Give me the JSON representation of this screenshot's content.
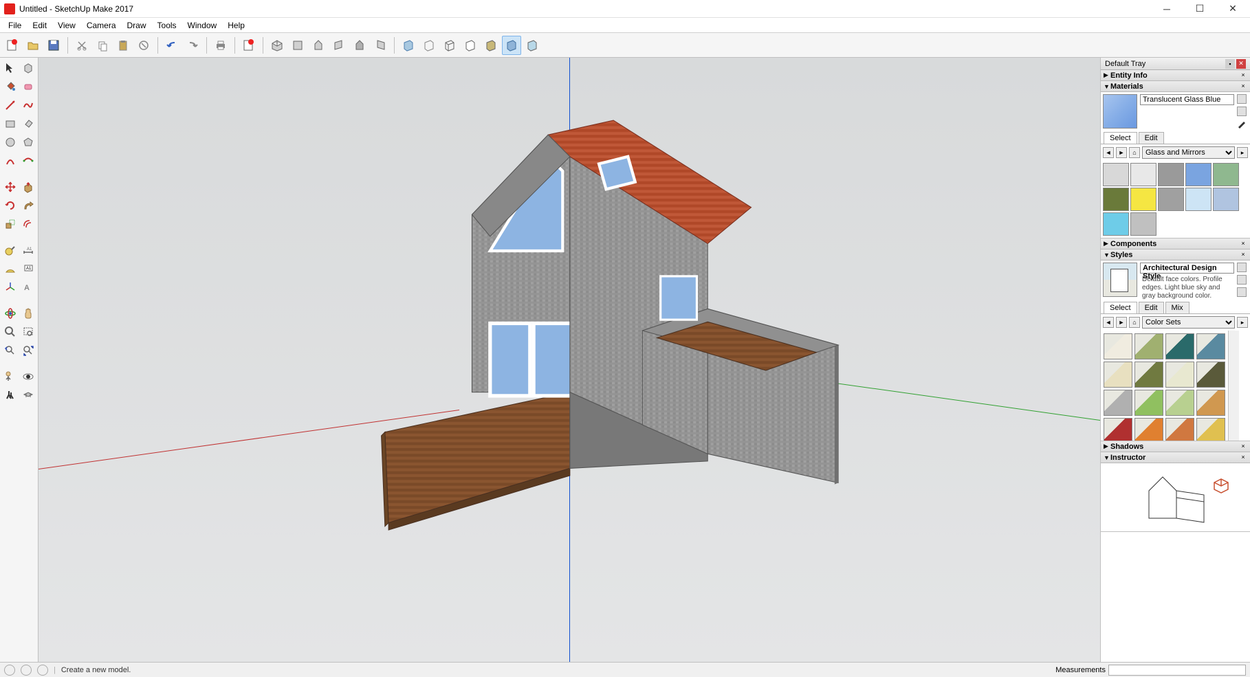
{
  "title": "Untitled - SketchUp Make 2017",
  "menu": [
    "File",
    "Edit",
    "View",
    "Camera",
    "Draw",
    "Tools",
    "Window",
    "Help"
  ],
  "tray": {
    "title": "Default Tray",
    "panels": {
      "entity_info": "Entity Info",
      "materials": {
        "title": "Materials",
        "name": "Translucent Glass Blue",
        "tabs": [
          "Select",
          "Edit"
        ],
        "library": "Glass and Mirrors",
        "swatches": [
          "#d8d8d8",
          "#e8e8e8",
          "#9a9a9a",
          "#7aa4e0",
          "#8fb88f",
          "#6a7a3a",
          "#f5e642",
          "#a0a0a0",
          "#cde4f5",
          "#b0c4e0",
          "#6ecce8",
          "#c0c0c0"
        ]
      },
      "components": "Components",
      "styles": {
        "title": "Styles",
        "name": "Architectural Design Style",
        "desc": "Default face colors. Profile edges. Light blue sky and gray background color.",
        "tabs": [
          "Select",
          "Edit",
          "Mix"
        ],
        "library": "Color Sets",
        "swatches": [
          "#f0ece0",
          "#a0b070",
          "#2a6a6a",
          "#5a8aa0",
          "#e8e0c0",
          "#707a40",
          "#e8e8d0",
          "#5a5a3a",
          "#b0b0b0",
          "#90c060",
          "#b8d090",
          "#d09850",
          "#b03030",
          "#e08030",
          "#d07840",
          "#e0c050"
        ]
      },
      "shadows": "Shadows",
      "instructor": "Instructor"
    }
  },
  "status": {
    "msg": "Create a new model.",
    "measure_label": "Measurements"
  }
}
